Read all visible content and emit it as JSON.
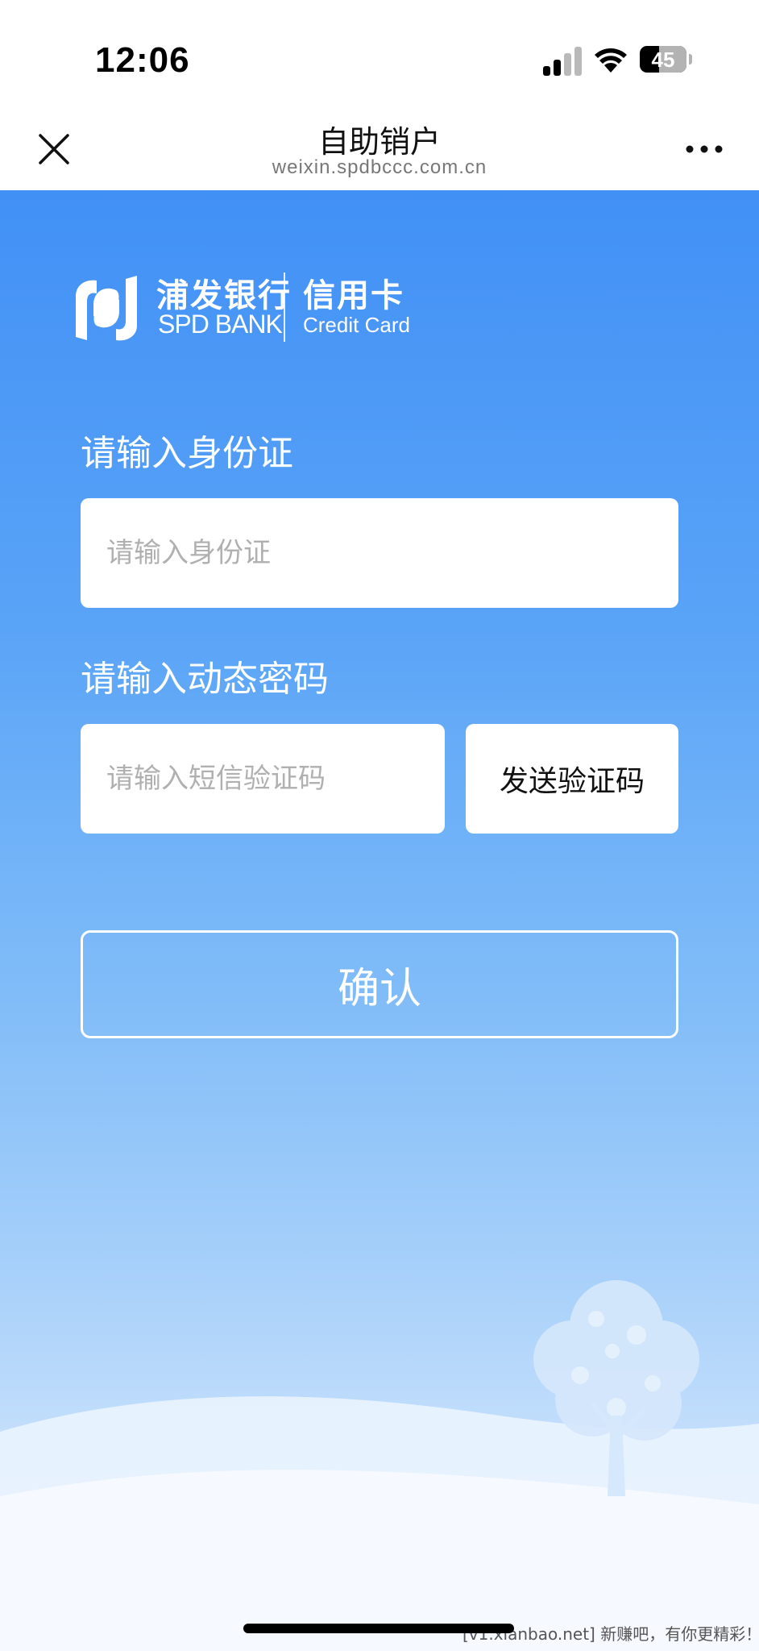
{
  "status_bar": {
    "time": "12:06",
    "battery": "45",
    "icons": [
      "cellular-signal-icon",
      "wifi-icon",
      "battery-icon"
    ]
  },
  "nav": {
    "title": "自助销户",
    "url": "weixin.spdbccc.com.cn",
    "icons": [
      "close-icon",
      "more-icon"
    ]
  },
  "logo": {
    "bank_cn": "浦发银行",
    "bank_en": "SPD BANK",
    "card_cn": "信用卡",
    "card_en": "Credit Card"
  },
  "form": {
    "id_label": "请输入身份证",
    "id_placeholder": "请输入身份证",
    "otp_label": "请输入动态密码",
    "otp_placeholder": "请输入短信验证码",
    "send_code": "发送验证码",
    "confirm": "确认"
  },
  "watermark": "[v1.xianbao.net] 新赚吧，有你更精彩！",
  "colors": {
    "gradient_top": "#4190f6",
    "gradient_bottom": "#eaf3fe",
    "text_on_blue": "#ffffff"
  }
}
